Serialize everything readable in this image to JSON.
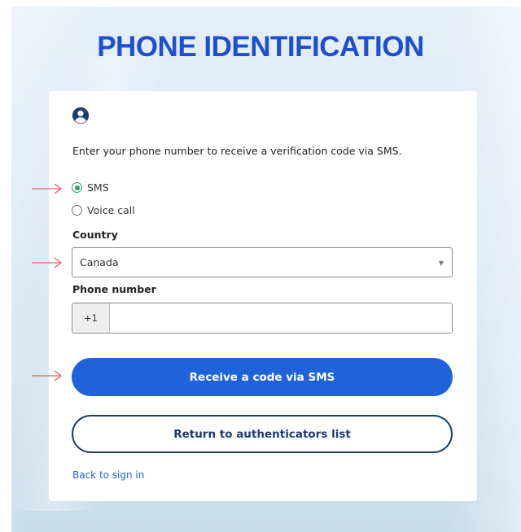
{
  "page": {
    "title": "PHONE IDENTIFICATION"
  },
  "card": {
    "icon": "user-circle-icon",
    "instruction": "Enter your phone number to receive a verification code via SMS.",
    "delivery_options": [
      {
        "label": "SMS",
        "selected": true
      },
      {
        "label": "Voice call",
        "selected": false
      }
    ],
    "country": {
      "label": "Country",
      "value": "Canada"
    },
    "phone": {
      "label": "Phone number",
      "prefix": "+1",
      "value": ""
    },
    "primary_button": "Receive a code via SMS",
    "secondary_button": "Return to authenticators list",
    "back_link": "Back to sign in"
  },
  "annotations": {
    "arrow_color": "#e8606f",
    "arrow_icon": "arrow-right-icon"
  },
  "colors": {
    "title": "#1d4fd0",
    "primary": "#1f63db",
    "secondary_border": "#1c3b74",
    "radio_selected": "#2d9d69"
  }
}
